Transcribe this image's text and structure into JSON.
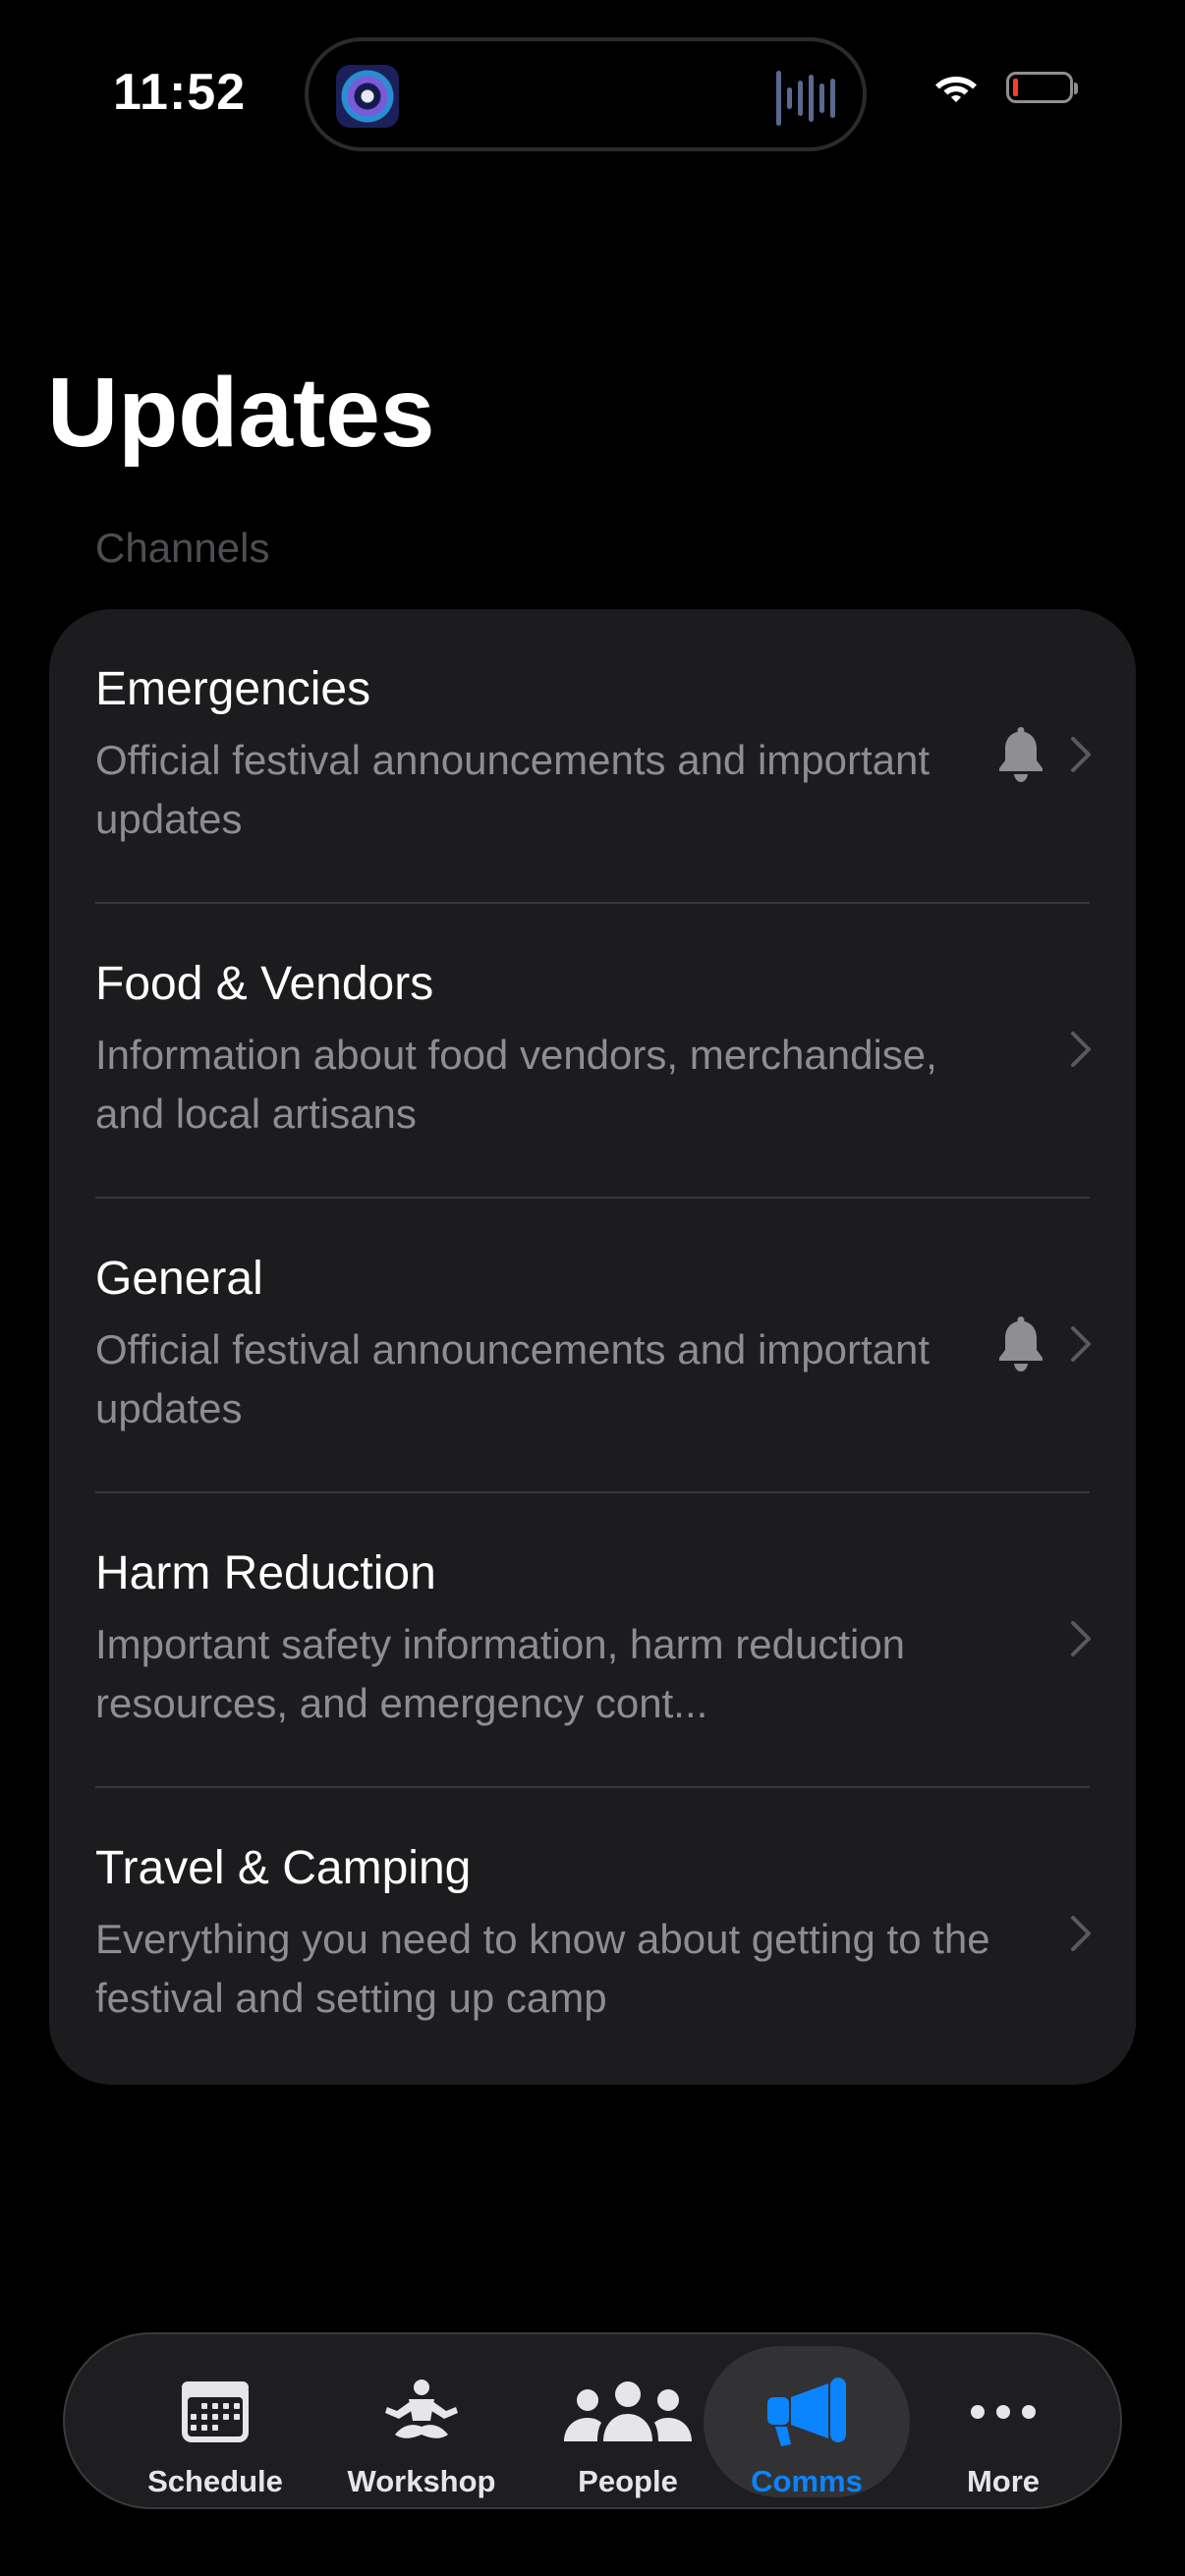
{
  "status_bar": {
    "time": "11:52",
    "battery_color": "#ff3b30"
  },
  "page": {
    "title": "Updates",
    "section_header": "Channels"
  },
  "channels": [
    {
      "title": "Emergencies",
      "description": "Official festival announcements and important updates",
      "notifications": true
    },
    {
      "title": "Food & Vendors",
      "description": "Information about food vendors, merchandise, and local artisans",
      "notifications": false
    },
    {
      "title": "General",
      "description": "Official festival announcements and important updates",
      "notifications": true
    },
    {
      "title": "Harm Reduction",
      "description": "Important safety information, harm reduction resources, and emergency cont...",
      "notifications": false
    },
    {
      "title": "Travel & Camping",
      "description": "Everything you need to know about getting to the festival and setting up camp",
      "notifications": false
    }
  ],
  "tab_bar": {
    "active_color": "#0a84ff",
    "tabs": [
      {
        "label": "Schedule",
        "icon": "calendar-icon",
        "active": false
      },
      {
        "label": "Workshop",
        "icon": "meditation-icon",
        "active": false
      },
      {
        "label": "People",
        "icon": "people-icon",
        "active": false
      },
      {
        "label": "Comms",
        "icon": "megaphone-icon",
        "active": true
      },
      {
        "label": "More",
        "icon": "ellipsis-icon",
        "active": false
      }
    ]
  }
}
